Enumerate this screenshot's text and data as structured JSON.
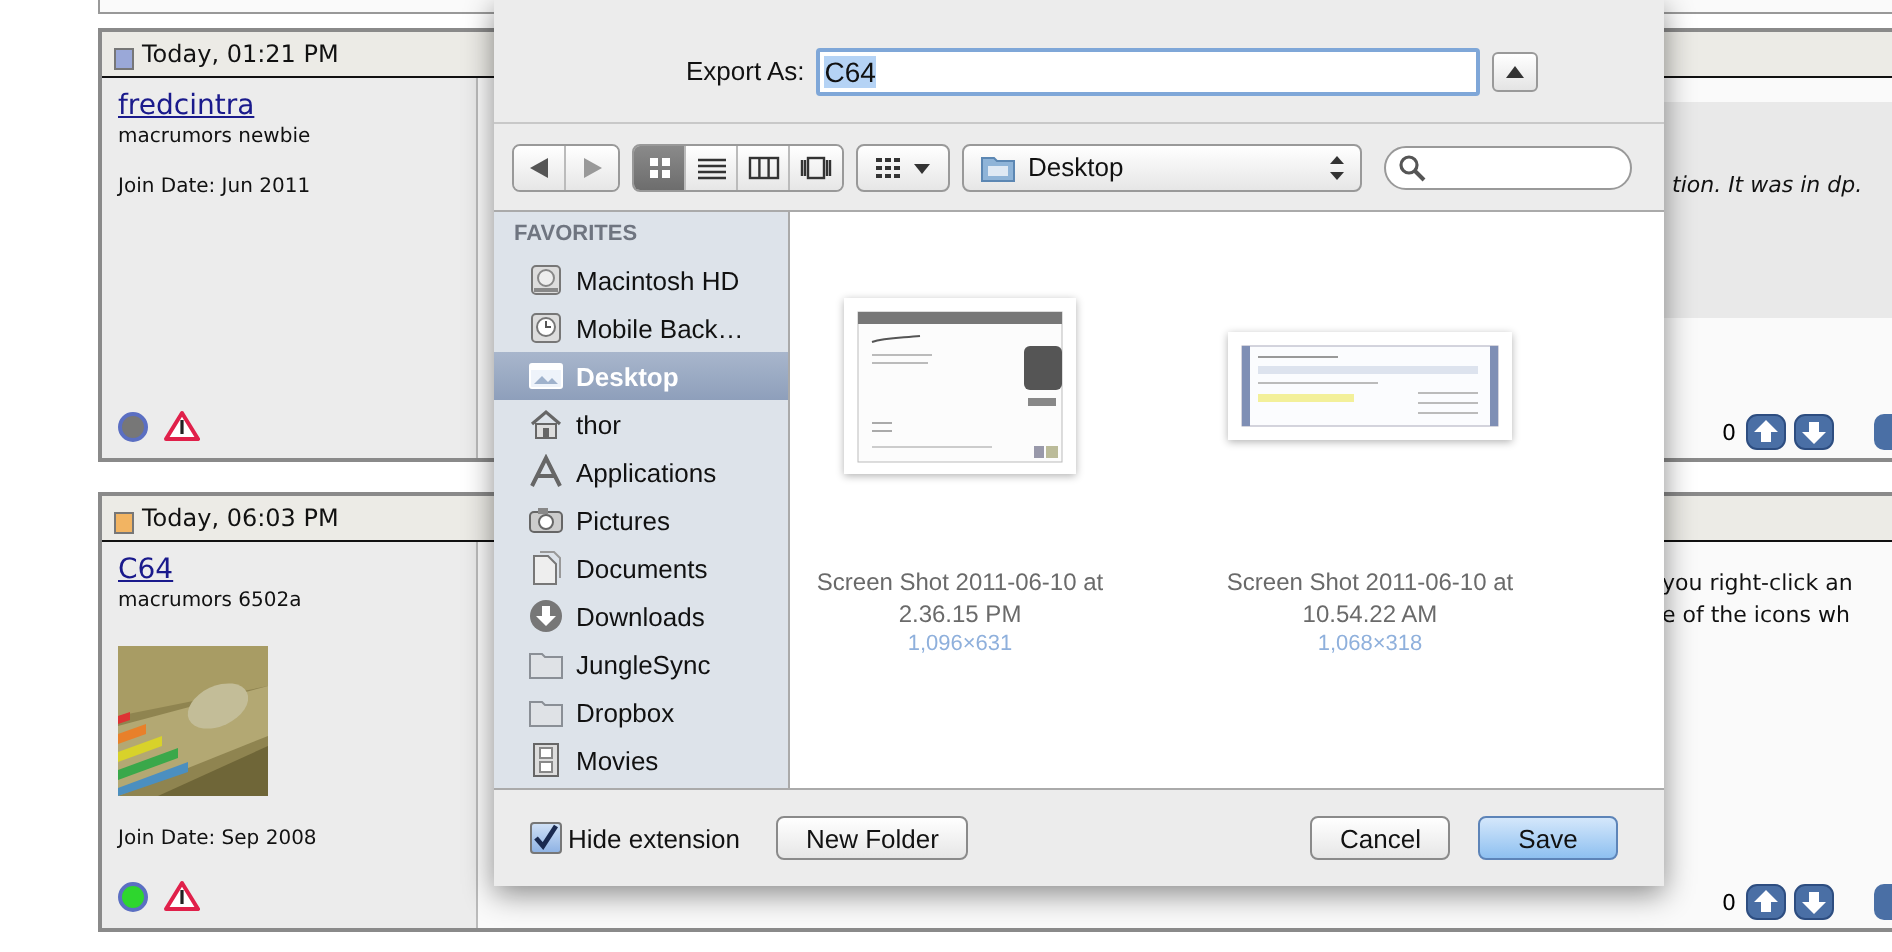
{
  "posts": [
    {
      "date": "Today, 01:21 PM",
      "color": "#9aa8d8",
      "username": "fredcintra",
      "rank": "macrumors newbie",
      "join_date": "Join Date: Jun 2011",
      "online": false,
      "quoted": true,
      "text_lines": [
        "tion. It was in dp."
      ],
      "votes": "0"
    },
    {
      "date": "Today, 06:03 PM",
      "color": "#f2b462",
      "username": "C64",
      "rank": "macrumors 6502a",
      "avatar": {
        "kind": "picture"
      },
      "join_date": "Join Date: Sep 2008",
      "online": true,
      "quoted": false,
      "text_lines": [
        "you right-click an",
        "e of the icons wh"
      ],
      "votes": "0"
    }
  ],
  "dialog": {
    "export_label": "Export As:",
    "filename": "C64",
    "view_modes": [
      {
        "kind": "icons",
        "selected": true
      },
      {
        "kind": "list",
        "selected": false
      },
      {
        "kind": "columns",
        "selected": false
      },
      {
        "kind": "coverflow",
        "selected": false
      }
    ],
    "location": "Desktop",
    "sidebar": {
      "heading": "FAVORITES",
      "items": [
        {
          "label": "Macintosh HD",
          "kind": "disk",
          "selected": false
        },
        {
          "label": "Mobile Back…",
          "kind": "clock",
          "selected": false
        },
        {
          "label": "Desktop",
          "kind": "desktop",
          "selected": true
        },
        {
          "label": "thor",
          "kind": "home",
          "selected": false
        },
        {
          "label": "Applications",
          "kind": "apps",
          "selected": false
        },
        {
          "label": "Pictures",
          "kind": "camera",
          "selected": false
        },
        {
          "label": "Documents",
          "kind": "docs",
          "selected": false
        },
        {
          "label": "Downloads",
          "kind": "download",
          "selected": false
        },
        {
          "label": "JungleSync",
          "kind": "folder",
          "selected": false
        },
        {
          "label": "Dropbox",
          "kind": "folder",
          "selected": false
        },
        {
          "label": "Movies",
          "kind": "film",
          "selected": false
        }
      ]
    },
    "files": [
      {
        "name": "Screen Shot 2011-06-10 at 2.36.15 PM",
        "dimensions": "1,096×631"
      },
      {
        "name": "Screen Shot 2011-06-10 at 10.54.22 AM",
        "dimensions": "1,068×318"
      }
    ],
    "hide_extension": {
      "label": "Hide extension",
      "checked": true
    },
    "buttons": [
      {
        "label": "New Folder",
        "kind": "plain"
      },
      {
        "label": "Cancel",
        "kind": "plain"
      },
      {
        "label": "Save",
        "kind": "default"
      }
    ]
  }
}
